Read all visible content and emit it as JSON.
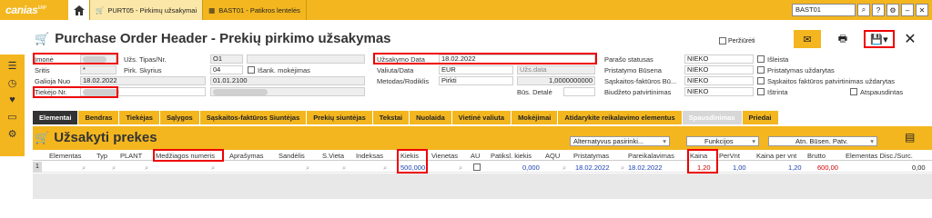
{
  "topbar": {
    "logo": "canias",
    "logo_sup": "ERP",
    "tabs": [
      {
        "label": "PURT05 - Pirkimų užsakymai",
        "active": true
      },
      {
        "label": "BAST01 - Patikros lentelės",
        "active": false
      }
    ],
    "search_value": "BAST01"
  },
  "header": {
    "title": "Purchase Order Header - Prekių pirkimo užsakymas",
    "preview_label": "Peržiūrėti"
  },
  "form": {
    "imone": "Įmonė",
    "uzs_tipas": "Užs. Tipas/Nr.",
    "uzs_tipas_val": "O1",
    "uzsakymo_data": "Užsakymo Data",
    "uzsakymo_data_val": "18.02.2022",
    "paraso_statusas": "Parašo statusas",
    "paraso_val": "NIEKO",
    "isleista": "Išleista",
    "sritis": "Sritis",
    "sritis_val": "*",
    "pirk_skyrius": "Pirk. Skyrius",
    "pirk_skyrius_val": "04",
    "isank_mokejimas": "Išank. mokėjimas",
    "valiuta": "Valiuta/Data",
    "valiuta_val": "EUR",
    "uzs_data": "Užs.data",
    "pristatymo_busena": "Pristatymo Būsena",
    "pristatymo_val": "NIEKO",
    "pristatymas_uzdarytas": "Pristatymas uždarytas",
    "galioja_nuo": "Galioja Nuo",
    "galioja_nuo_val": "18.02.2022",
    "galioja_iki_val": "01.01.2100",
    "metodas": "Metodas/Rodiklis",
    "metodas_val": "Pirkti",
    "rodiklis_val": "1,0000000000",
    "saskaitos_busena": "Sąskaitos-faktūros Bū...",
    "saskaitos_val": "NIEKO",
    "saskaitos_uzdarymas": "Sąskaitos faktūros patvirtinimas uždarytas",
    "tiekejo_nr": "Tiekėjo Nr.",
    "bus_detale": "Būs. Detalė",
    "biudzeto": "Biudžeto patvirtinimas",
    "biudzeto_val": "NIEKO",
    "istrinta": "Ištrinta",
    "atspausdintas": "Atspausdintas"
  },
  "tabs": [
    {
      "label": "Elementai",
      "state": "active"
    },
    {
      "label": "Bendras",
      "state": "normal"
    },
    {
      "label": "Tiekėjas",
      "state": "normal"
    },
    {
      "label": "Sąlygos",
      "state": "normal"
    },
    {
      "label": "Sąskaitos-faktūros Siuntėjas",
      "state": "normal"
    },
    {
      "label": "Prekių siuntėjas",
      "state": "normal"
    },
    {
      "label": "Tekstai",
      "state": "normal"
    },
    {
      "label": "Nuolaida",
      "state": "normal"
    },
    {
      "label": "Vietinė valiuta",
      "state": "normal"
    },
    {
      "label": "Mokėjimai",
      "state": "normal"
    },
    {
      "label": "Atidarykite reikalavimo elementus",
      "state": "normal"
    },
    {
      "label": "Spausdinimas",
      "state": "disabled"
    },
    {
      "label": "Priedai",
      "state": "normal"
    }
  ],
  "section": {
    "title": "Užsakyti prekes",
    "alt_label": "Alternatyvus pasirinki...",
    "funkcijos_label": "Funkcijos",
    "atn_label": "Atn. Būsen. Patv."
  },
  "grid": {
    "headers": [
      "Elementas",
      "Typ",
      "PLANT",
      "Medžiagos numeris",
      "Aprašymas",
      "Sandėlis",
      "S.Vieta",
      "Indeksas",
      "Kiekis",
      "Vienetas",
      "AU",
      "Patiksl. kiekis",
      "AQU",
      "Pristatymas",
      "Pareikalavimas",
      "Kaina",
      "PerVnt",
      "Kaina per vnt",
      "Brutto",
      "Elementas Disc./Surc."
    ],
    "row": {
      "num": "1",
      "kiekis": "500,000",
      "patiksl_kiekis": "0,000",
      "pristatymas": "18.02.2022",
      "pareikalavimas": "18.02.2022",
      "kaina": "1,20",
      "pervnt": "1,00",
      "kaina_per_vnt": "1,20",
      "brutto": "600,00",
      "disc": "0,00"
    }
  },
  "colors": {
    "accent": "#f3b61f",
    "highlight": "#e00000",
    "value_blue": "#1a3fb0"
  }
}
